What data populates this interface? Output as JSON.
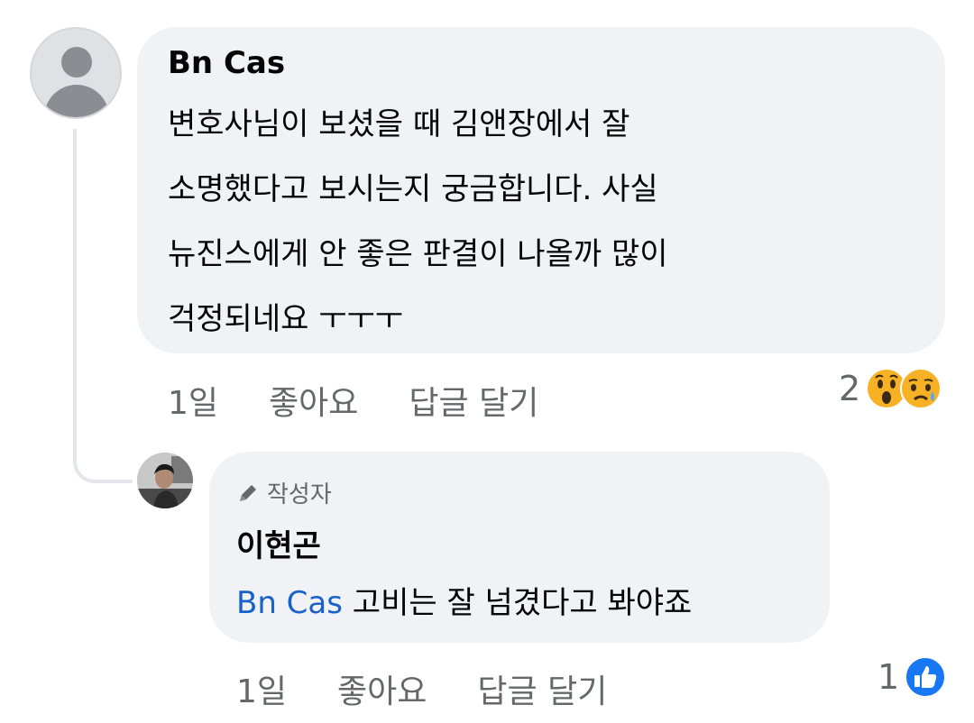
{
  "comment": {
    "author": "Bn Cas",
    "lines": [
      "변호사님이 보셨을 때 김앤장에서 잘",
      "소명했다고 보시는지 궁금합니다. 사실",
      "뉴진스에게 안 좋은 판결이 나올까 많이",
      "걱정되네요 ㅜㅜㅜ"
    ],
    "time": "1일",
    "like_label": "좋아요",
    "reply_label": "답글 달기",
    "reaction_count": "2",
    "reactions": [
      "wow-emoji-icon",
      "sad-emoji-icon"
    ]
  },
  "reply": {
    "badge_label": "작성자",
    "author": "이현곤",
    "mention": "Bn Cas",
    "text": " 고비는 잘 넘겼다고 봐야죠",
    "time": "1일",
    "like_label": "좋아요",
    "reply_label": "답글 달기",
    "reaction_count": "1",
    "reactions": [
      "like-icon"
    ]
  },
  "colors": {
    "bubble": "#f0f2f5",
    "secondary_text": "#65676b",
    "mention": "#1861c8",
    "like_blue": "#1877f2"
  }
}
